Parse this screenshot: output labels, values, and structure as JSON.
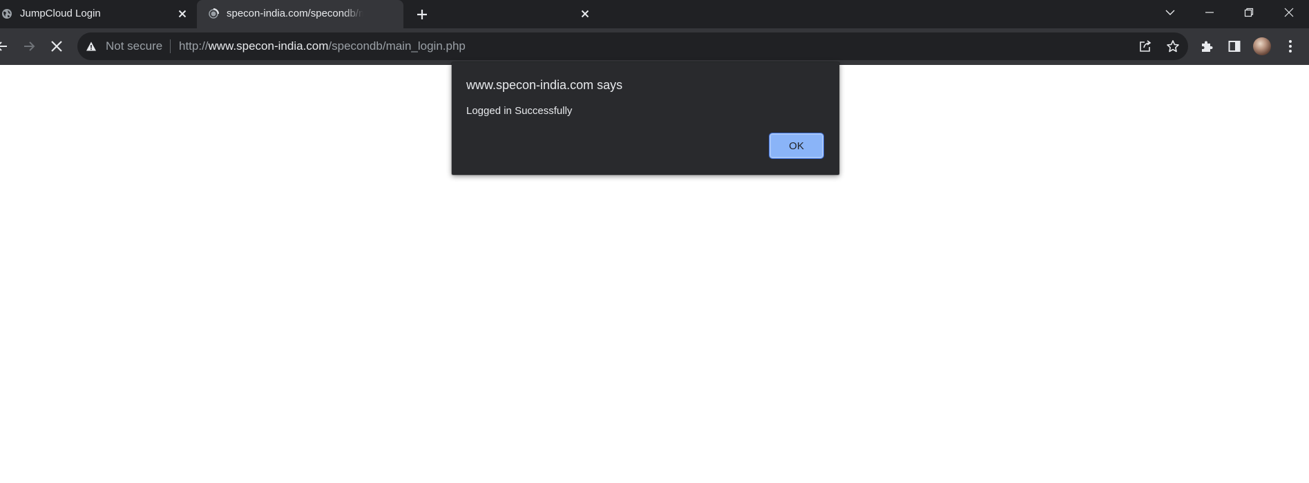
{
  "tabs": [
    {
      "title": "JumpCloud Login",
      "favicon": "globe-icon",
      "active": false
    },
    {
      "title": "specon-india.com/specondb/main_login.php",
      "favicon": "loading-globe-icon",
      "active": true
    }
  ],
  "new_tab_icon": "plus-icon",
  "window_controls": [
    "tab-search-icon",
    "minimize-icon",
    "restore-icon",
    "close-icon"
  ],
  "toolbar": {
    "nav_icons": [
      "back-arrow-icon",
      "forward-arrow-icon",
      "stop-loading-icon"
    ],
    "security_label": "Not secure",
    "url_scheme": "http://",
    "url_host": "www.specon-india.com",
    "url_path": "/specondb/main_login.php",
    "omnibox_icons": [
      "share-icon",
      "bookmark-star-icon"
    ],
    "extra_icons": [
      "extensions-puzzle-icon",
      "side-panel-icon",
      "profile-avatar",
      "kebab-menu-icon"
    ]
  },
  "dialog": {
    "title": "www.specon-india.com says",
    "message": "Logged in Successfully",
    "ok_label": "OK"
  },
  "colors": {
    "tabstrip_bg": "#202124",
    "toolbar_bg": "#35363a",
    "omnibox_bg": "#202124",
    "dialog_bg": "#292a2d",
    "ok_button_bg": "#8ab4f8",
    "page_bg": "#ffffff"
  }
}
